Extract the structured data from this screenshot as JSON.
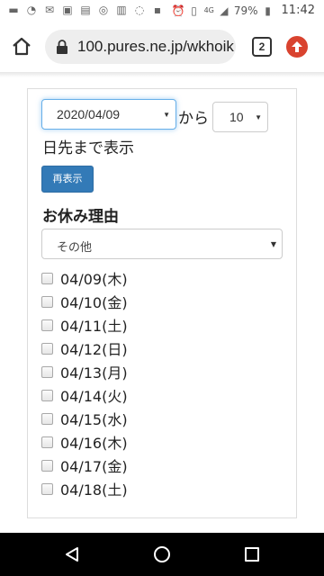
{
  "status_bar": {
    "battery": "79%",
    "time": "11:42",
    "network": "4G"
  },
  "browser": {
    "url": "100.pures.ne.jp/wkhoik",
    "tab_count": "2"
  },
  "form": {
    "start_date": "2020/04/09",
    "kara": "から",
    "days": "10",
    "suffix": "日先まで表示",
    "redisplay_label": "再表示",
    "reason_label": "お休み理由",
    "reason_value": "その他"
  },
  "dates": [
    {
      "label": "04/09(木)",
      "checked": false
    },
    {
      "label": "04/10(金)",
      "checked": false
    },
    {
      "label": "04/11(土)",
      "checked": false
    },
    {
      "label": "04/12(日)",
      "checked": false
    },
    {
      "label": "04/13(月)",
      "checked": false
    },
    {
      "label": "04/14(火)",
      "checked": false
    },
    {
      "label": "04/15(水)",
      "checked": false
    },
    {
      "label": "04/16(木)",
      "checked": false
    },
    {
      "label": "04/17(金)",
      "checked": false
    },
    {
      "label": "04/18(土)",
      "checked": false
    }
  ]
}
